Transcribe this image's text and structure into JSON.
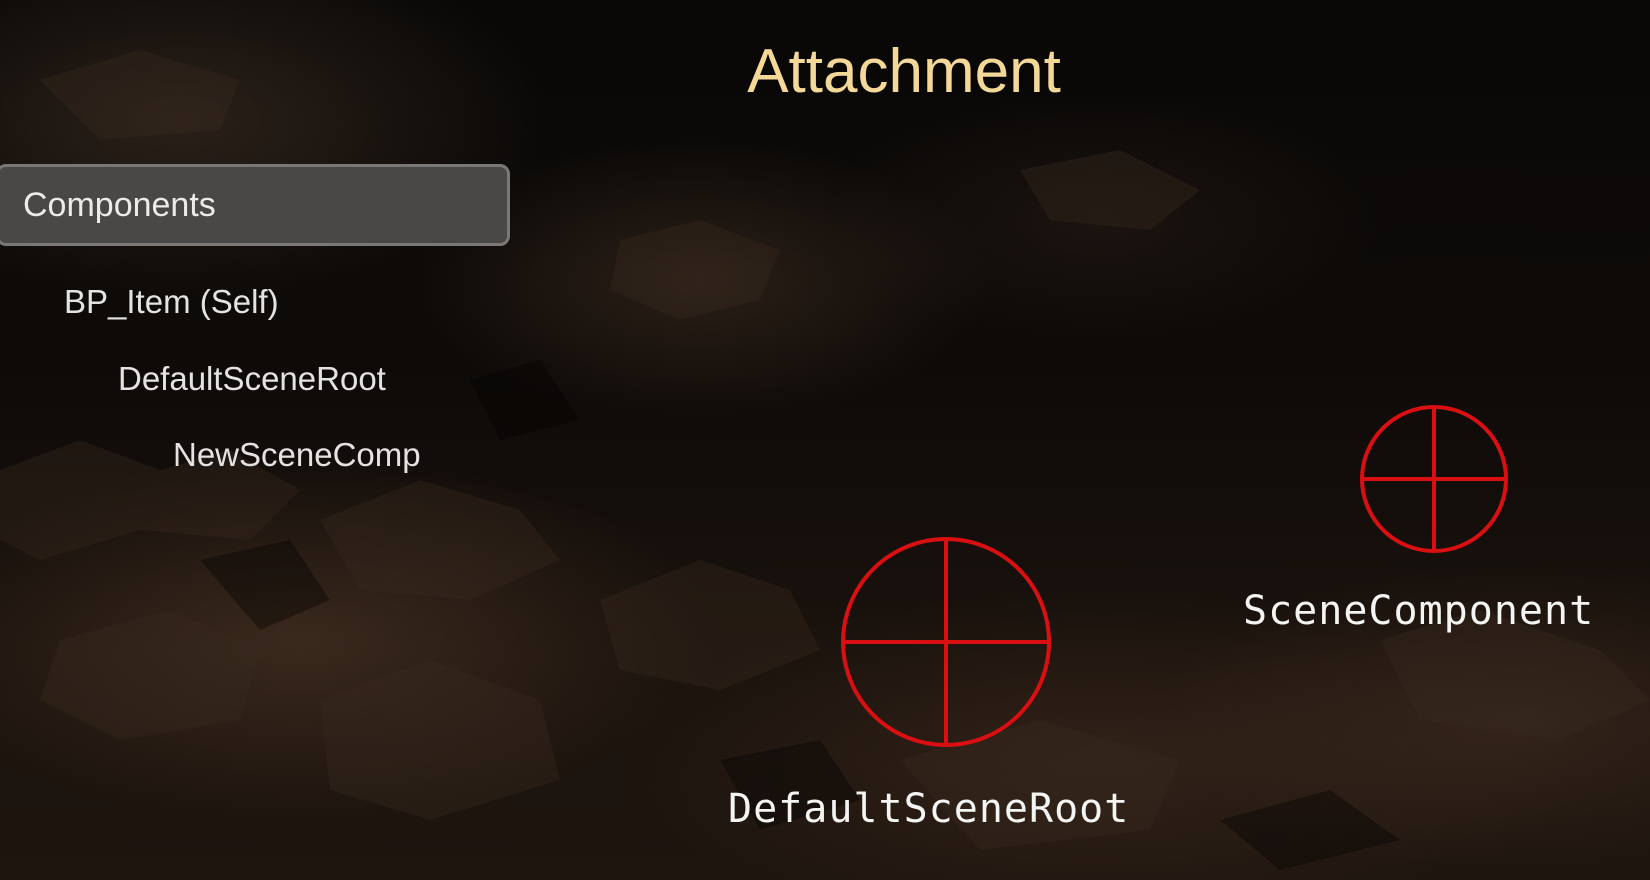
{
  "slide": {
    "title": "Attachment"
  },
  "components_panel": {
    "header": "Components",
    "tree": [
      {
        "label": "BP_Item (Self)",
        "level": 0
      },
      {
        "label": "DefaultSceneRoot",
        "level": 1
      },
      {
        "label": "NewSceneComp",
        "level": 2
      }
    ]
  },
  "viewport": {
    "gizmos": [
      {
        "label": "DefaultSceneRoot",
        "icon": "scene-component-crosshair-icon"
      },
      {
        "label": "SceneComponent",
        "icon": "scene-component-crosshair-icon"
      }
    ],
    "gizmo_color": "#d90f12",
    "title_color": "#f3d898"
  }
}
